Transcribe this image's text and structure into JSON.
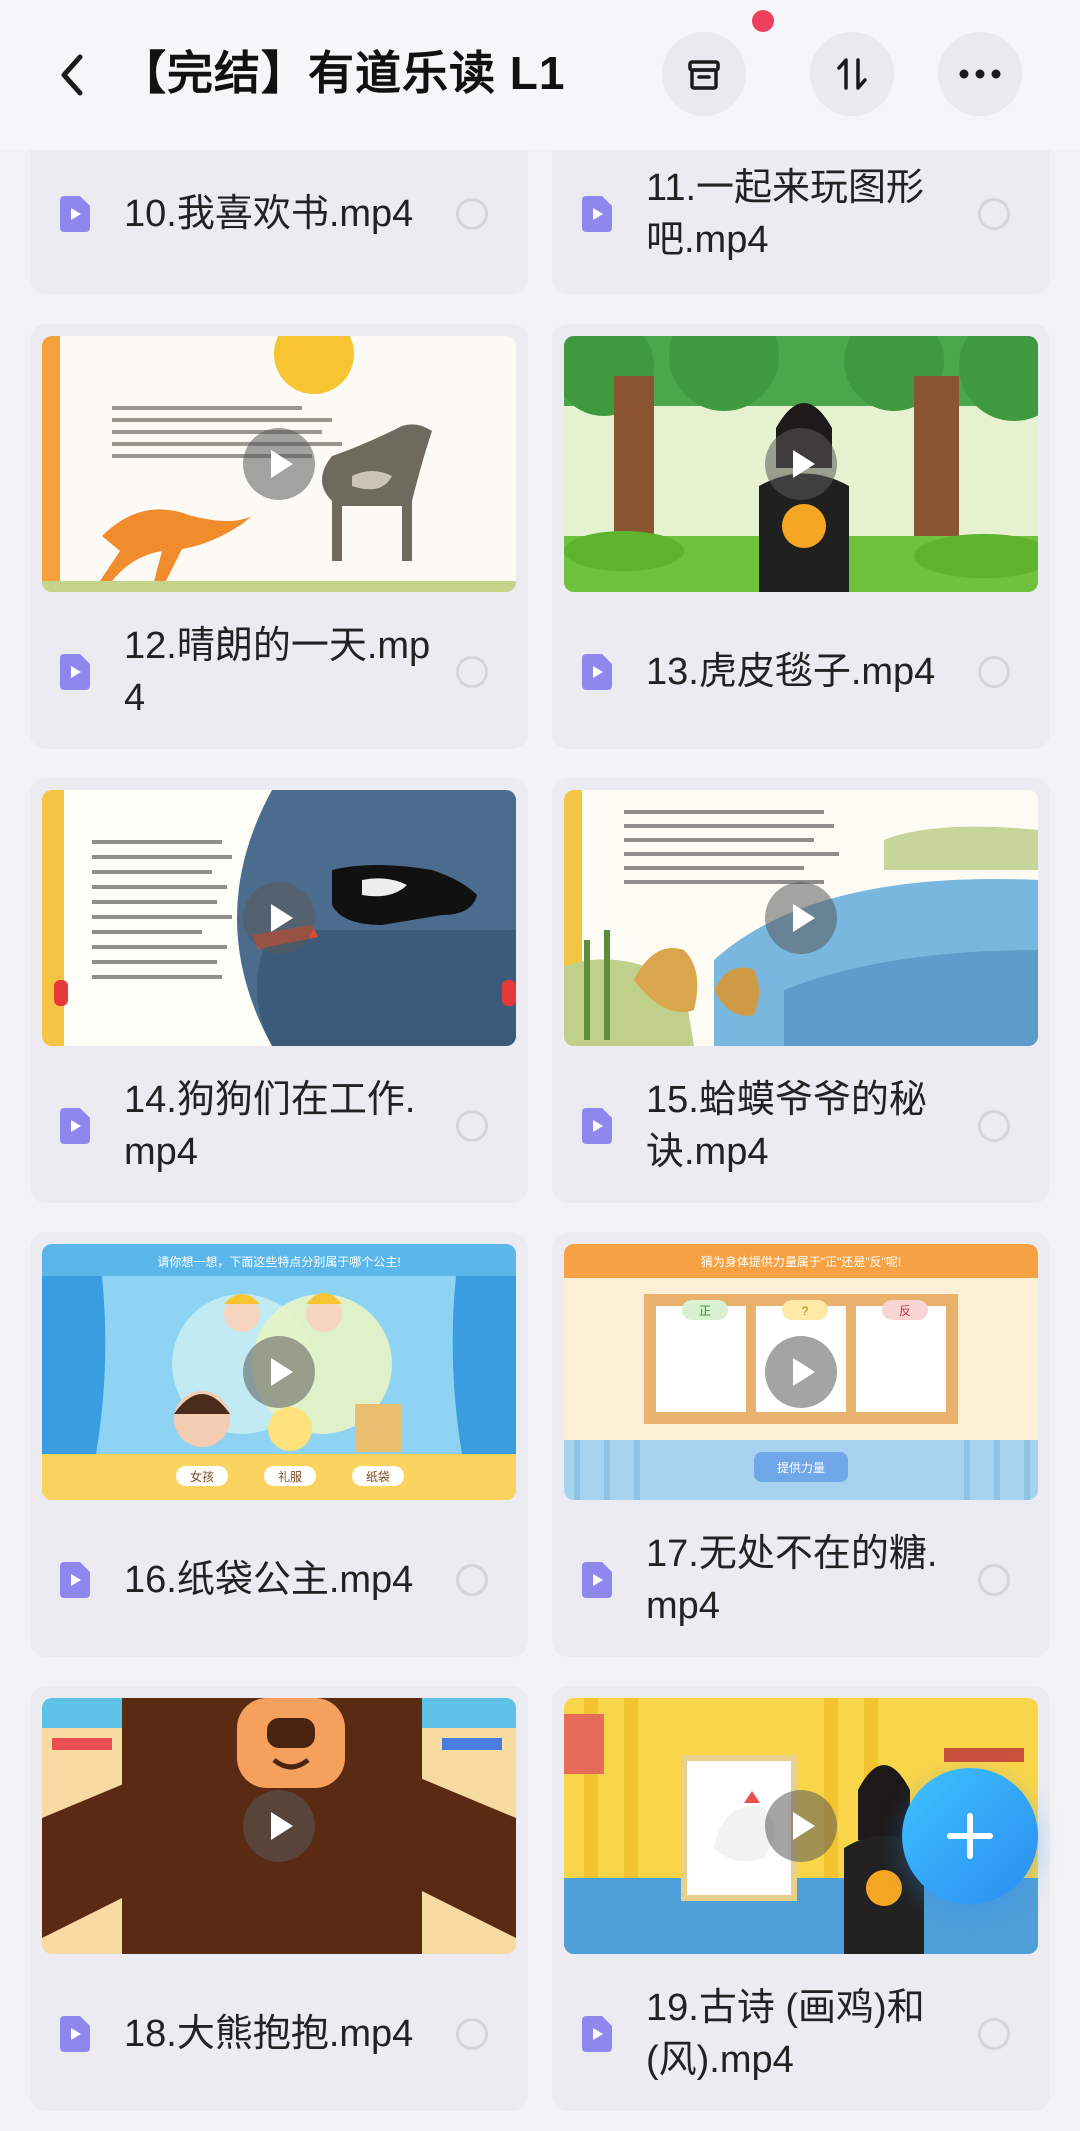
{
  "header": {
    "title": "【完结】有道乐读 L1",
    "back_icon": "chevron-left-icon",
    "buttons": [
      "archive-icon",
      "sort-icon",
      "more-icon"
    ]
  },
  "files": [
    {
      "name": "10.我喜欢书.mp4"
    },
    {
      "name": "11.一起来玩图形吧.mp4"
    },
    {
      "name": "12.晴朗的一天.mp4"
    },
    {
      "name": "13.虎皮毯子.mp4"
    },
    {
      "name": "14.狗狗们在工作.mp4"
    },
    {
      "name": "15.蛤蟆爷爷的秘诀.mp4"
    },
    {
      "name": "16.纸袋公主.mp4"
    },
    {
      "name": "17.无处不在的糖.mp4"
    },
    {
      "name": "18.大熊抱抱.mp4"
    },
    {
      "name": "19.古诗 (画鸡)和(风).mp4"
    }
  ],
  "thumbs": {
    "t16": {
      "banner": "请你想一想，下面这些特点分别属于哪个公主!",
      "l1": "女孩",
      "l2": "礼服",
      "l3": "纸袋"
    },
    "t17": {
      "banner": "猜为身体提供力量属于\"正\"还是\"反\"呢!",
      "b1": "正",
      "b2": "?",
      "b3": "反",
      "bottom": "提供力量"
    }
  },
  "fab": {
    "icon": "plus-icon"
  },
  "colors": {
    "accent": "#2a8df0",
    "file_icon": "#8f86ee",
    "background": "#f3f3f7"
  }
}
